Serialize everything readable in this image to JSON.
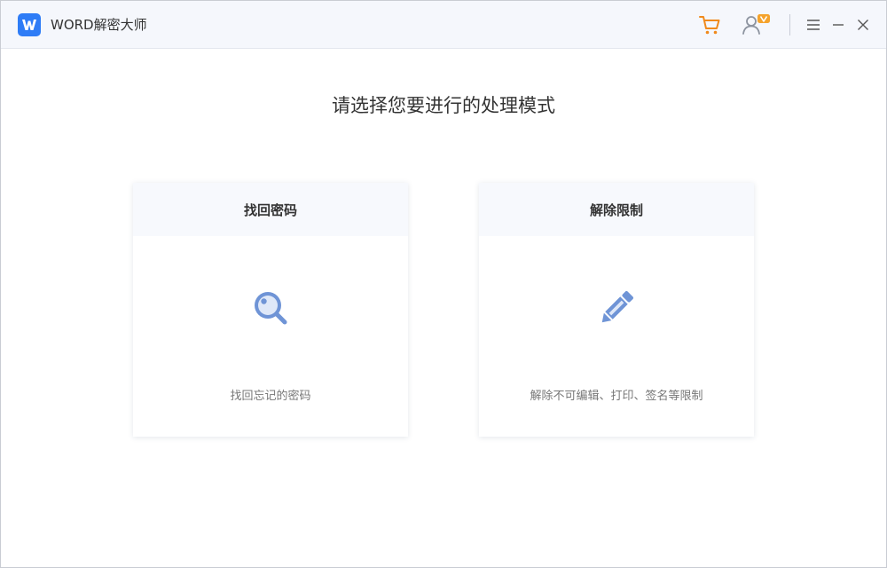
{
  "app": {
    "title": "WORD解密大师",
    "logo_letter": "W",
    "accent_color": "#2e7cf6",
    "cart_color": "#f08a1c"
  },
  "titlebar": {
    "icons": [
      "cart-icon",
      "user-vip-icon",
      "menu-icon",
      "minimize-icon",
      "close-icon"
    ],
    "vip_badge": "V"
  },
  "main": {
    "heading": "请选择您要进行的处理模式",
    "cards": [
      {
        "title": "找回密码",
        "icon": "magnifier-icon",
        "description": "找回忘记的密码"
      },
      {
        "title": "解除限制",
        "icon": "pencil-icon",
        "description": "解除不可编辑、打印、签名等限制"
      }
    ]
  }
}
